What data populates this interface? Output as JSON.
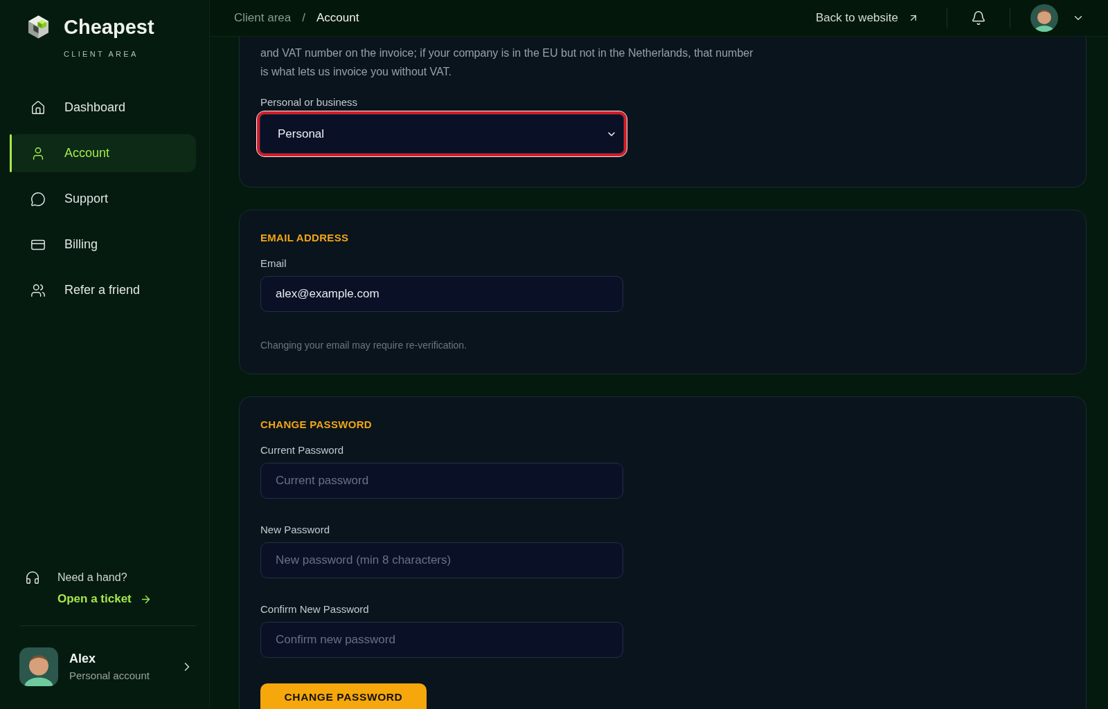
{
  "sidebar": {
    "brand": {
      "name": "Cheapest",
      "subtitle": "CLIENT AREA"
    },
    "nav": [
      {
        "label": "Dashboard",
        "selected": false
      },
      {
        "label": "Account",
        "selected": true
      },
      {
        "label": "Support",
        "selected": false
      },
      {
        "label": "Billing",
        "selected": false
      },
      {
        "label": "Refer a friend",
        "selected": false
      }
    ],
    "help": {
      "text": "Need a hand?",
      "link": "Open a ticket"
    },
    "user": {
      "name": "Alex",
      "account_type": "Personal account"
    }
  },
  "header": {
    "breadcrumb": [
      {
        "label": "Client area",
        "current": false
      },
      {
        "label": "Account",
        "current": true
      }
    ],
    "separator": "/",
    "back_link": "Back to website"
  },
  "sections": [
    {
      "intro": "and VAT number on the invoice; if your company is in the EU but not in the Netherlands, that number is what lets us invoice you without VAT.",
      "fields": [
        {
          "kind": "select",
          "label": "Personal or business",
          "value": "Personal",
          "focused": true
        }
      ]
    },
    {
      "title": "EMAIL ADDRESS",
      "fields": [
        {
          "kind": "input",
          "label": "Email",
          "value": "alex@example.com",
          "focused": false
        }
      ],
      "note": "Changing your email may require re-verification."
    },
    {
      "title": "CHANGE PASSWORD",
      "fields": [
        {
          "kind": "input",
          "label": "Current Password",
          "placeholder": "Current password",
          "focused": false
        },
        {
          "kind": "input",
          "label": "New Password",
          "placeholder": "New password (min 8 characters)",
          "focused": false
        },
        {
          "kind": "input",
          "label": "Confirm New Password",
          "placeholder": "Confirm new password",
          "focused": false
        }
      ],
      "button": "CHANGE PASSWORD"
    }
  ]
}
